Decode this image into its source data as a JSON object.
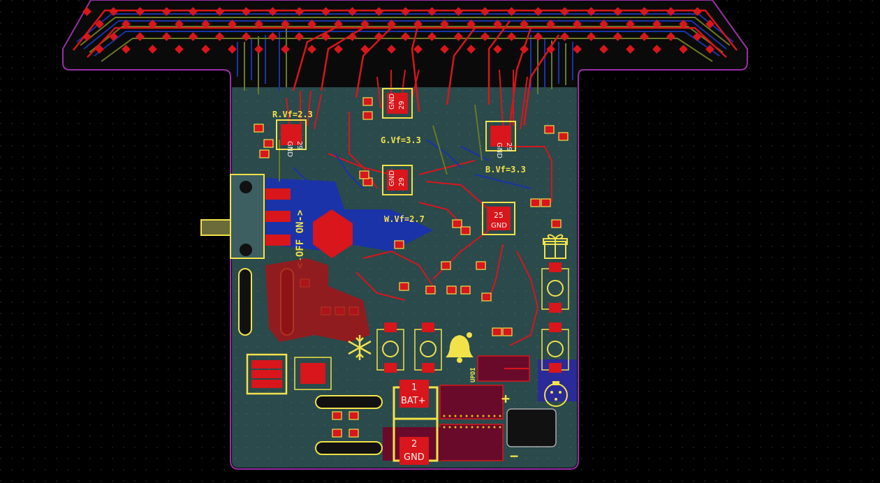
{
  "colors": {
    "background": "#000000",
    "board_fill": "#2a4a4c",
    "outline": "#9a2fa6",
    "copper_front": "#d8161b",
    "copper_back": "#1a33a8",
    "inner_traces": "#6b7a22",
    "silkscreen": "#f2e24a",
    "pad_dark": "#6a0a2a"
  },
  "board": {
    "labels": {
      "red_vf": "R.Vf=2.3",
      "green_vf": "G.Vf=3.3",
      "blue_vf": "B.Vf=3.3",
      "white_vf": "W.Vf=2.7",
      "switch": "<-OFF ON->",
      "updi": "UPDI",
      "plus": "+",
      "minus": "−"
    },
    "chips": [
      {
        "id": "u-red",
        "num": "29",
        "pin": "GND"
      },
      {
        "id": "u-green",
        "num": "29",
        "pin": "GND"
      },
      {
        "id": "u-blue",
        "num": "29",
        "pin": "GND"
      },
      {
        "id": "u-white",
        "num": "29",
        "pin": "GND"
      },
      {
        "id": "u-mcu",
        "num": "25",
        "pin": "GND"
      }
    ],
    "battery": {
      "pad1_num": "1",
      "pad1_name": "BAT+",
      "pad2_num": "2",
      "pad2_name": "GND"
    },
    "icons": [
      "gift-icon",
      "snowflake-icon",
      "bell-icon",
      "ornament-icon"
    ]
  }
}
